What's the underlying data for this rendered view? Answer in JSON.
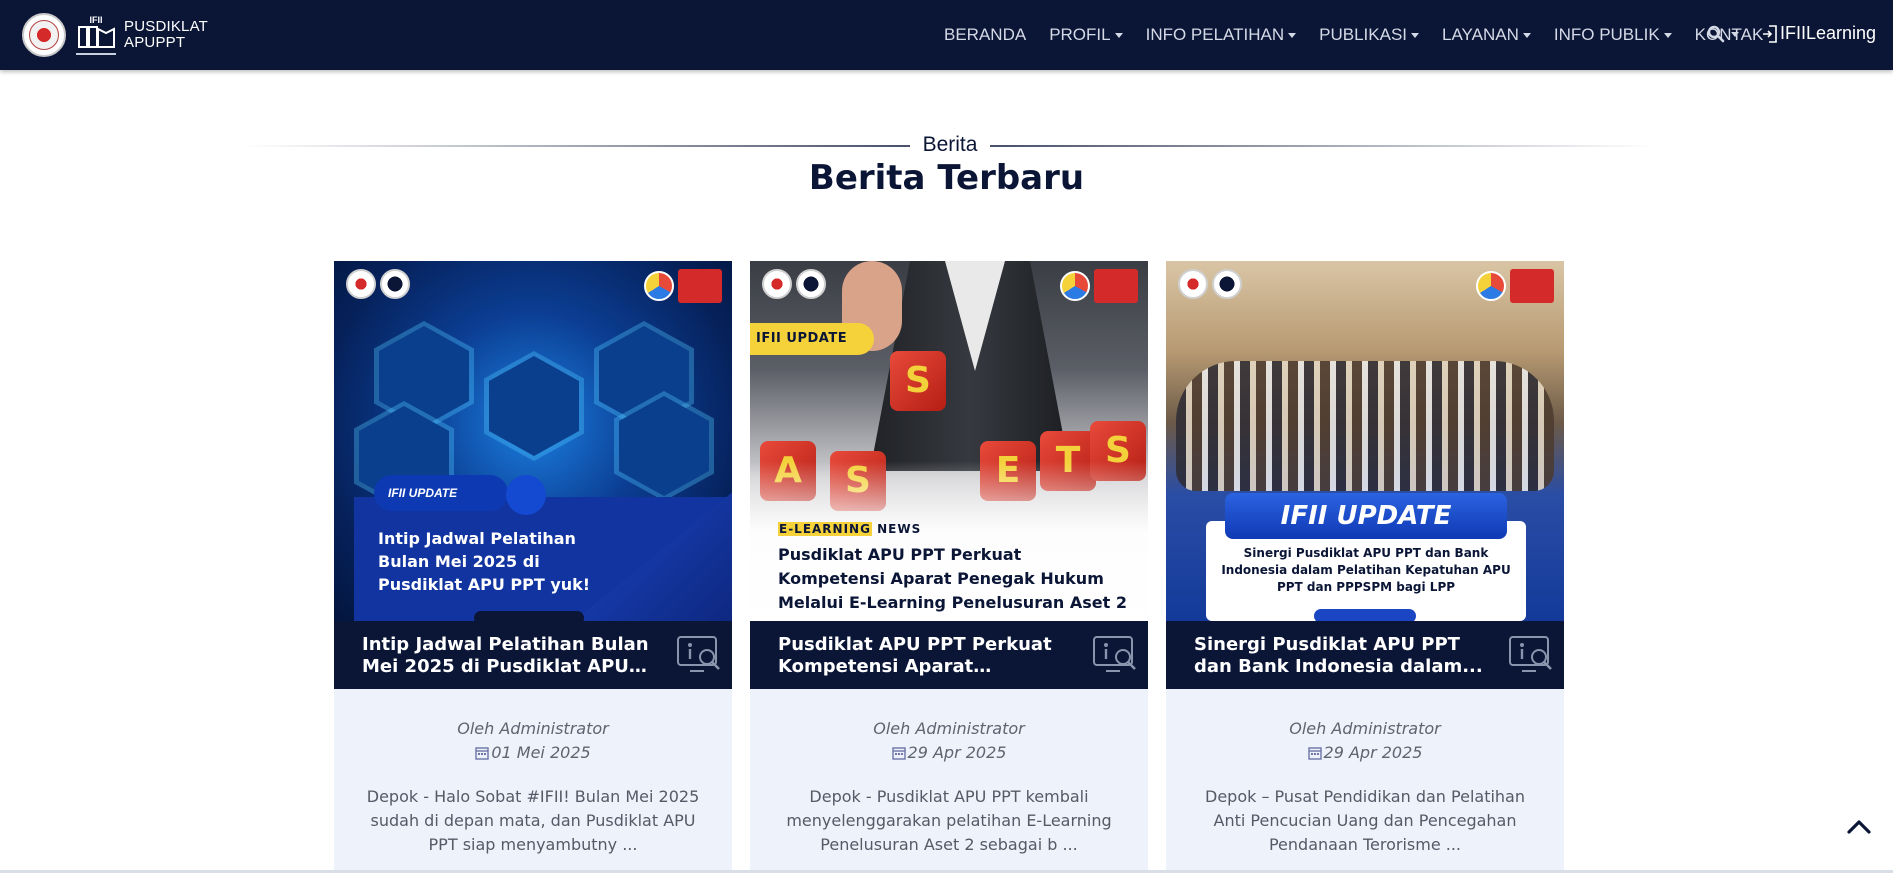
{
  "brand": {
    "line1": "PUSDIKLAT",
    "line2": "APUPPT",
    "logo_text": "IFII"
  },
  "nav": {
    "items": [
      {
        "label": "BERANDA",
        "dropdown": false
      },
      {
        "label": "PROFIL",
        "dropdown": true
      },
      {
        "label": "INFO PELATIHAN",
        "dropdown": true
      },
      {
        "label": "PUBLIKASI",
        "dropdown": true
      },
      {
        "label": "LAYANAN",
        "dropdown": true
      },
      {
        "label": "INFO PUBLIK",
        "dropdown": true
      },
      {
        "label": "KONTAK",
        "dropdown": false
      }
    ],
    "search_icon": "search-icon",
    "login_label": "IFIILearning",
    "login_icon": "sign-in-icon"
  },
  "section": {
    "kicker": "Berita",
    "title": "Berita Terbaru"
  },
  "cards": [
    {
      "image_badge": "IFII UPDATE",
      "image_headline": "Intip Jadwal Pelatihan Bulan Mei 2025 di Pusdiklat APU PPT yuk!",
      "title": "Intip Jadwal Pelatihan Bulan Mei 2025 di Pusdiklat APU PPT...",
      "author": "Oleh Administrator",
      "date": "01 Mei 2025",
      "excerpt": "Depok - Halo Sobat #IFII! Bulan Mei 2025 sudah di depan mata, dan Pusdiklat APU PPT siap menyambutny ..."
    },
    {
      "image_badge": "IFII UPDATE",
      "image_kicker_hl": "E-LEARNING",
      "image_kicker_rest": " NEWS",
      "image_headline": "Pusdiklat APU PPT Perkuat Kompetensi Aparat Penegak Hukum Melalui E-Learning Penelusuran Aset 2",
      "title": "Pusdiklat APU PPT Perkuat Kompetensi Aparat Penegak...",
      "author": "Oleh Administrator",
      "date": "29 Apr 2025",
      "excerpt": "Depok - Pusdiklat APU PPT kembali menyelenggarakan pelatihan E-Learning Penelusuran Aset 2 sebagai b ..."
    },
    {
      "image_badge": "IFII UPDATE",
      "image_headline": "Sinergi Pusdiklat APU PPT dan Bank Indonesia dalam Pelatihan Kepatuhan APU PPT dan PPPSPM bagi LPP",
      "title": "Sinergi Pusdiklat APU PPT dan Bank Indonesia dalam...",
      "author": "Oleh Administrator",
      "date": "29 Apr 2025",
      "excerpt": "Depok – Pusat Pendidikan dan Pelatihan Anti Pencucian Uang dan Pencegahan Pendanaan Terorisme ..."
    }
  ],
  "colors": {
    "navy": "#0b1637",
    "card_bg": "#eef2fb",
    "accent_yellow": "#f6d23a"
  },
  "back_to_top_icon": "chevron-up-icon"
}
